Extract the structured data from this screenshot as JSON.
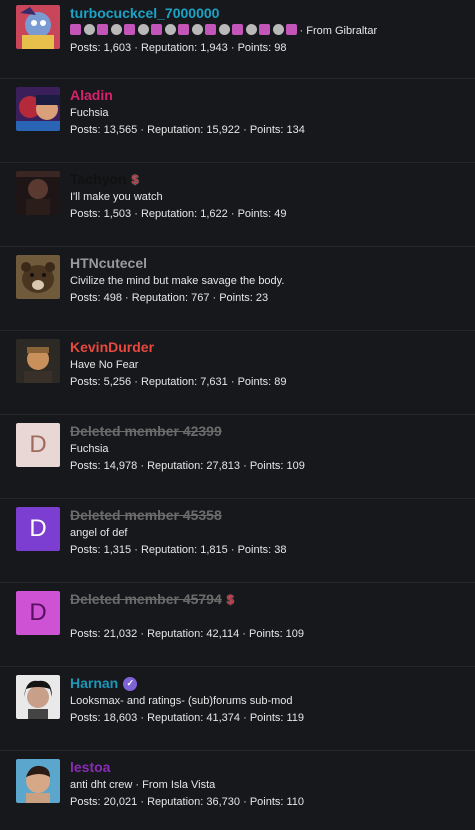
{
  "members": [
    {
      "name": "turbocuckcel_7000000",
      "name_color": "#1aa3c6",
      "deleted": false,
      "subline": "· From Gibraltar",
      "badges": 17,
      "posts_label": "Posts: 1,603",
      "rep_label": "Reputation: 1,943",
      "points_label": "Points: 98",
      "avatar": "anime-character-avatar"
    },
    {
      "name": "Aladin",
      "name_color": "#d8206b",
      "deleted": false,
      "subline": "Fuchsia",
      "posts_label": "Posts: 13,565",
      "rep_label": "Reputation: 15,922",
      "points_label": "Points: 134",
      "avatar": "cartoon-couple-avatar"
    },
    {
      "name": "Tachyon",
      "name_color": "#111111",
      "deleted": false,
      "dollar": "$",
      "subline": "I'll make you watch",
      "posts_label": "Posts: 1,503",
      "rep_label": "Reputation: 1,622",
      "points_label": "Points: 49",
      "avatar": "dark-man-avatar"
    },
    {
      "name": "HTNcutecel",
      "name_color": "#9a9a9a",
      "deleted": false,
      "subline": "Civilize the mind but make savage the body.",
      "posts_label": "Posts: 498",
      "rep_label": "Reputation: 767",
      "points_label": "Points: 23",
      "avatar": "bear-avatar"
    },
    {
      "name": "KevinDurder",
      "name_color": "#e8493e",
      "deleted": false,
      "subline": "Have No Fear",
      "posts_label": "Posts: 5,256",
      "rep_label": "Reputation: 7,631",
      "points_label": "Points: 89",
      "avatar": "man-portrait-avatar"
    },
    {
      "name": "Deleted member 42399",
      "name_color": "#6b6b6b",
      "deleted": true,
      "letter": "D",
      "letter_bg": "#e8d7d4",
      "letter_color": "#a06b5e",
      "subline": "Fuchsia",
      "posts_label": "Posts: 14,978",
      "rep_label": "Reputation: 27,813",
      "points_label": "Points: 109"
    },
    {
      "name": "Deleted member 45358",
      "name_color": "#6b6b6b",
      "deleted": true,
      "letter": "D",
      "letter_bg": "#7c3dd1",
      "letter_color": "#ffffff",
      "subline": "angel of def",
      "posts_label": "Posts: 1,315",
      "rep_label": "Reputation: 1,815",
      "points_label": "Points: 38"
    },
    {
      "name": "Deleted member 45794",
      "name_color": "#6b6b6b",
      "deleted": true,
      "dollar": "$",
      "letter": "D",
      "letter_bg": "#cd52d4",
      "letter_color": "#5a0f63",
      "subline": "",
      "posts_label": "Posts: 21,032",
      "rep_label": "Reputation: 42,114",
      "points_label": "Points: 109"
    },
    {
      "name": "Harnan",
      "name_color": "#1b97b8",
      "deleted": false,
      "verified": true,
      "subline": "Looksmax- and ratings- (sub)forums sub-mod",
      "posts_label": "Posts: 18,603",
      "rep_label": "Reputation: 41,374",
      "points_label": "Points: 119",
      "avatar": "dark-hair-man-avatar"
    },
    {
      "name": "lestoa",
      "name_color": "#8a2bb5",
      "deleted": false,
      "subline": "anti dht crew · From Isla Vista",
      "posts_label": "Posts: 20,021",
      "rep_label": "Reputation: 36,730",
      "points_label": "Points: 110",
      "avatar": "model-man-avatar"
    }
  ],
  "separator": " · "
}
